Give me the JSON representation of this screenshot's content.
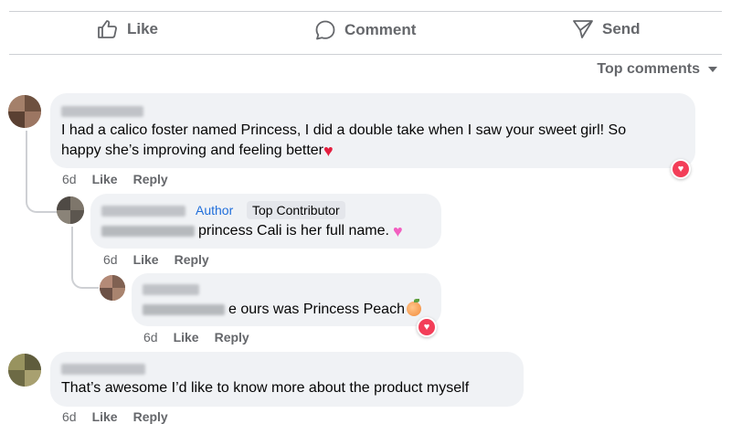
{
  "actions": {
    "like": "Like",
    "comment": "Comment",
    "send": "Send"
  },
  "sort": {
    "label": "Top comments"
  },
  "comments": [
    {
      "text_line1": "I had a calico foster named Princess, I did a double take when I saw your sweet girl! So",
      "text_line2": "happy she’s improving and feeling better",
      "meta": {
        "time": "6d",
        "like": "Like",
        "reply": "Reply"
      }
    },
    {
      "badge_author": "Author",
      "badge_tc": "Top Contributor",
      "text": "princess Cali is her full name.",
      "meta": {
        "time": "6d",
        "like": "Like",
        "reply": "Reply"
      }
    },
    {
      "text": "e ours was Princess Peach",
      "meta": {
        "time": "6d",
        "like": "Like",
        "reply": "Reply"
      }
    },
    {
      "text": "That’s awesome I’d like to know more about the product myself",
      "meta": {
        "time": "6d",
        "like": "Like",
        "reply": "Reply"
      }
    }
  ],
  "colors": {
    "bubble": "#f0f2f5",
    "secondary_text": "#65676b",
    "author_blue": "#216fdb",
    "love_reaction": "#f33e58"
  },
  "icons": [
    "like-icon",
    "comment-icon",
    "send-icon",
    "caret-down-icon",
    "love-reaction-icon",
    "red-heart-emoji",
    "pink-heart-emoji",
    "peach-emoji"
  ]
}
